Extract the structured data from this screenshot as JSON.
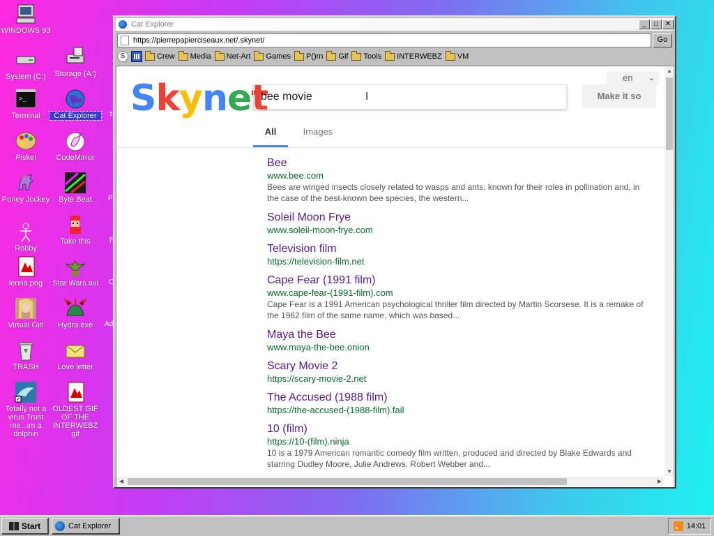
{
  "desktop": {
    "icons": [
      {
        "label": "WINDOWS 93"
      },
      {
        "label": "System (C:)"
      },
      {
        "label": "Storage (A:)"
      },
      {
        "label": "Terminal"
      },
      {
        "label": "Cat Explorer"
      },
      {
        "label": "Piskel"
      },
      {
        "label": "CodeMirror"
      },
      {
        "label": "Poney Jockey"
      },
      {
        "label": "Byte Beat"
      },
      {
        "label": "Robby"
      },
      {
        "label": "Take this"
      },
      {
        "label": "lenna.png"
      },
      {
        "label": "Star Wars.avi"
      },
      {
        "label": "Virtual Girl"
      },
      {
        "label": "Hydra.exe"
      },
      {
        "label": "TRASH"
      },
      {
        "label": "Love letter"
      },
      {
        "label": "Totally not a virus.Trust me...im a dolphin"
      },
      {
        "label": "OLDEST GIF OF THE INTERWEBZ gif"
      }
    ],
    "clipped_labels": [
      "T",
      "P",
      "F",
      "C",
      "Ad"
    ]
  },
  "window": {
    "title": "Cat Explorer",
    "min_glyph": "_",
    "max_glyph": "□",
    "close_glyph": "✕",
    "address": "https://pierrepapierciseaux.net/.skynet/",
    "go_label": "Go",
    "bookmarks": [
      "Crew",
      "Media",
      "Net-Art",
      "Games",
      "P()rn",
      "Gif",
      "Tools",
      "INTERWEBZ",
      "VM"
    ],
    "bookmark_s": "S"
  },
  "page": {
    "logo_letters": [
      "S",
      "k",
      "y",
      "n",
      "e",
      "t"
    ],
    "logo_colors": [
      "#4285f4",
      "#ea4335",
      "#fbbc05",
      "#4285f4",
      "#34a853",
      "#ea4335"
    ],
    "search_value": "bee movie",
    "make_it_so": "Make it so",
    "lang": "en",
    "tabs": [
      "All",
      "Images"
    ],
    "results": [
      {
        "title": "Bee",
        "url": "www.bee.com",
        "desc": "Bees are winged insects closely related to wasps and ants, known for their roles in pollination and, in the case of the best-known bee species, the western..."
      },
      {
        "title": "Soleil Moon Frye",
        "url": "www.soleil-moon-frye.com",
        "desc": ""
      },
      {
        "title": "Television film",
        "url": "https://television-film.net",
        "desc": ""
      },
      {
        "title": "Cape Fear (1991 film)",
        "url": "www.cape-fear-(1991-film).com",
        "desc": "Cape Fear is a 1991 American psychological thriller film directed by Martin Scorsese. It is a remake of the 1962 film of the same name, which was based..."
      },
      {
        "title": "Maya the Bee",
        "url": "www.maya-the-bee.onion",
        "desc": ""
      },
      {
        "title": "Scary Movie 2",
        "url": "https://scary-movie-2.net",
        "desc": ""
      },
      {
        "title": "The Accused (1988 film)",
        "url": "https://the-accused-(1988-film).fail",
        "desc": ""
      },
      {
        "title": "10 (film)",
        "url": "https://10-(film).ninja",
        "desc": "10 is a 1979 American romantic comedy film written, produced and directed by Blake Edwards and starring Dudley Moore, Julie Andrews, Robert Webber and..."
      }
    ]
  },
  "taskbar": {
    "start_label": "Start",
    "task_label": "Cat Explorer",
    "clock": "14:01"
  },
  "colors": {
    "link_visited": "#551a8b",
    "url_green": "#0a6b2a",
    "tab_active": "#4285f4"
  }
}
